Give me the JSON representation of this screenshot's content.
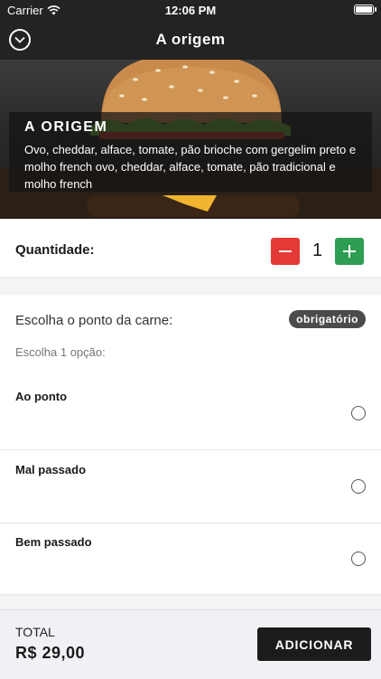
{
  "status_bar": {
    "carrier": "Carrier",
    "time": "12:06 PM",
    "icons": [
      "wifi-icon",
      "battery-icon"
    ]
  },
  "nav": {
    "title": "A origem",
    "back_icon": "chevron-down-circle-icon"
  },
  "product": {
    "name": "A ORIGEM",
    "description": "Ovo, cheddar, alface, tomate, pão brioche com gergelim preto e molho french ovo, cheddar, alface, tomate, pão tradicional e molho french"
  },
  "quantity": {
    "label": "Quantidade:",
    "value": "1",
    "colors": {
      "minus": "#e53935",
      "plus": "#2e9e53"
    }
  },
  "options": {
    "heading": "Escolha o ponto da carne:",
    "badge": "obrigatório",
    "hint": "Escolha 1 opção:",
    "items": [
      {
        "label": "Ao ponto",
        "selected": false
      },
      {
        "label": "Mal passado",
        "selected": false
      },
      {
        "label": "Bem passado",
        "selected": false
      }
    ]
  },
  "footer": {
    "total_label": "TOTAL",
    "total_value": "R$ 29,00",
    "add_button": "ADICIONAR"
  }
}
